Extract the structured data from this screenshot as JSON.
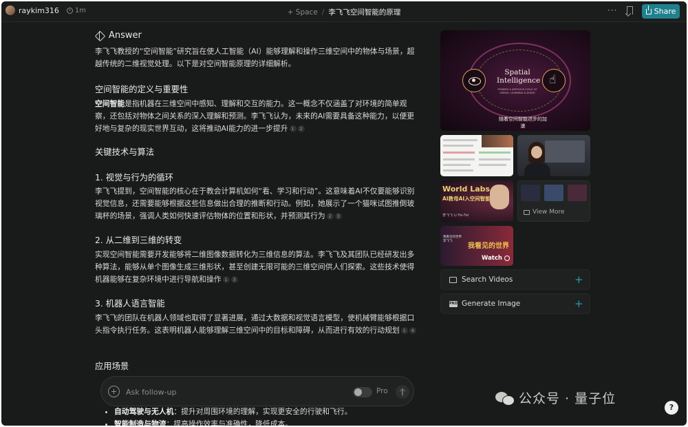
{
  "topbar": {
    "username": "raykim316",
    "time": "1m",
    "space_label": "+ Space",
    "separator": "/",
    "thread_title": "李飞飞空间智能的原理",
    "more": "···",
    "share_label": "Share"
  },
  "answer": {
    "heading": "Answer",
    "intro": "李飞飞教授的“空间智能”研究旨在使人工智能（AI）能够理解和操作三维空间中的物体与场景，超越传统的二维视觉处理。以下是对空间智能原理的详细解析。",
    "sec1_title": "空间智能的定义与重要性",
    "sec1_bold": "空间智能",
    "sec1_text": "是指机器在三维空间中感知、理解和交互的能力。这一概念不仅涵盖了对环境的简单观察，还包括对物体之间关系的深入理解和预测。李飞飞认为，未来的AI需要具备这种能力，以便更好地与复杂的现实世界互动，这将推动AI能力的进一步提升",
    "sec1_cites": [
      "1",
      "2"
    ],
    "sec2_title": "关键技术与算法",
    "sub1_title": "1. 视觉与行为的循环",
    "sub1_text": "李飞飞提到，空间智能的核心在于教会计算机如何“看、学习和行动”。这意味着AI不仅要能够识别视觉信息，还需要能够根据这些信息做出合理的推断和行动。例如，她展示了一个猫咪试图推倒玻璃杯的场景，强调人类如何快速评估物体的位置和形状，并预测其行为",
    "sub1_cites": [
      "2",
      "3"
    ],
    "sub2_title": "2. 从二维到三维的转变",
    "sub2_text": "实现空间智能需要开发能够将二维图像数据转化为三维信息的算法。李飞飞及其团队已经研发出多种算法，能够从单个图像生成三维形状，甚至创建无限可能的三维空间供人们探索。这些技术使得机器能够在复杂环境中进行导航和操作",
    "sub2_cites": [
      "1",
      "3"
    ],
    "sub3_title": "3. 机器人语言智能",
    "sub3_text": "李飞飞的团队在机器人领域也取得了显著进展，通过大数据和视觉语言模型，使机械臂能够根据口头指令执行任务。这表明机器人能够理解三维空间中的目标和障碍，从而进行有效的行动规划",
    "sub3_cites": [
      "1",
      "4"
    ],
    "sec3_title": "应用场景",
    "bullets": [
      {
        "bold": "自动驾驶与无人机",
        "text": "：提升对周围环境的理解，实现更安全的行驶和飞行。"
      },
      {
        "bold": "智能制造与物流",
        "text": "：提高操作效率与准确性，降低成本。"
      }
    ]
  },
  "followup": {
    "placeholder": "Ask follow-up",
    "pro_label": "Pro"
  },
  "media": {
    "hero_title": "Spatial Intelligence",
    "hero_subtitle": "POWERS A VIRTUOUS CYCLE OF SEEING, LEARNING & DOING",
    "hero_caption": "随着空间智能进步的加速",
    "thumb3_title": "World Labs",
    "thumb3_subtitle": "AI教母AI入空间智能",
    "thumb3_footer": "李飞飞 Li Fei-Fei",
    "view_more": "View More",
    "thumb5_title": "我看见的世界",
    "thumb5_small": "我看见的世界 李飞飞",
    "thumb5_watch": "Watch"
  },
  "actions": {
    "search_videos": "Search Videos",
    "generate_image": "Generate Image",
    "add": "+"
  },
  "watermark": "公众号 · 量子位",
  "help": "?",
  "icons": [
    "clock-icon",
    "bookmark-icon",
    "share-icon",
    "answer-icon",
    "plus-circle-icon",
    "send-arrow-icon",
    "video-icon",
    "image-gen-icon",
    "image-icon",
    "play-icon",
    "wechat-icon",
    "help-icon"
  ],
  "colors": {
    "accent": "#21808d",
    "background": "#191a1a"
  }
}
